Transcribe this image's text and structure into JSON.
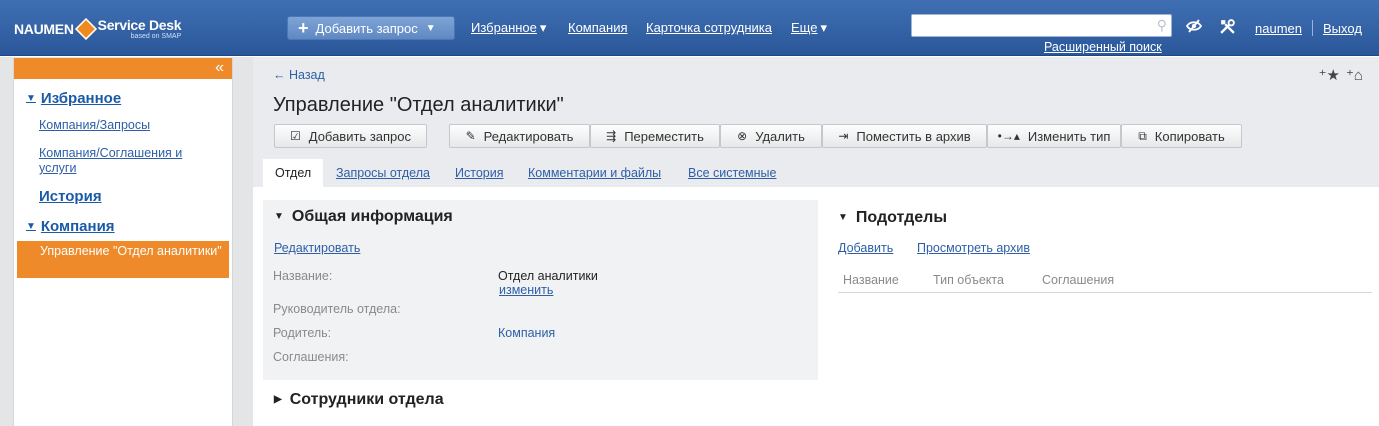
{
  "header": {
    "logo_left": "NAUMEN",
    "logo_right": "Service Desk",
    "logo_sub": "based on SMAP",
    "add_request": "Добавить запрос",
    "nav": [
      "Избранное",
      "Компания",
      "Карточка сотрудника",
      "Еще"
    ],
    "search_value": "",
    "advanced_search": "Расширенный поиск",
    "user": "naumen",
    "logout": "Выход"
  },
  "sidebar": {
    "sections": {
      "favorites": "Избранное",
      "history": "История",
      "company": "Компания"
    },
    "fav_links": [
      "Компания/Запросы",
      "Компания/Соглашения и услуги"
    ],
    "active_item": "Управление \"Отдел аналитики\""
  },
  "main": {
    "back": "Назад",
    "title": "Управление \"Отдел аналитики\"",
    "toolbar": {
      "add_request": "Добавить запрос",
      "edit": "Редактировать",
      "move": "Переместить",
      "delete": "Удалить",
      "archive": "Поместить в архив",
      "change_type": "Изменить тип",
      "copy": "Копировать"
    },
    "tabs": [
      "Отдел",
      "Запросы отдела",
      "История",
      "Комментарии и файлы",
      "Все системные"
    ]
  },
  "general_info": {
    "title": "Общая информация",
    "edit_link": "Редактировать",
    "fields": {
      "name_label": "Название:",
      "name_value": "Отдел аналитики",
      "name_change": "изменить",
      "head_label": "Руководитель отдела:",
      "parent_label": "Родитель:",
      "parent_value": "Компания",
      "agreements_label": "Соглашения:"
    }
  },
  "subdivisions": {
    "title": "Подотделы",
    "add": "Добавить",
    "view_archive": "Просмотреть архив",
    "columns": [
      "Название",
      "Тип объекта",
      "Соглашения"
    ]
  },
  "employees": {
    "title": "Сотрудники отдела"
  },
  "colors": {
    "header_blue": "#2f5fa5",
    "accent_orange": "#ef8a2b",
    "link_blue": "#2e5fa6"
  }
}
